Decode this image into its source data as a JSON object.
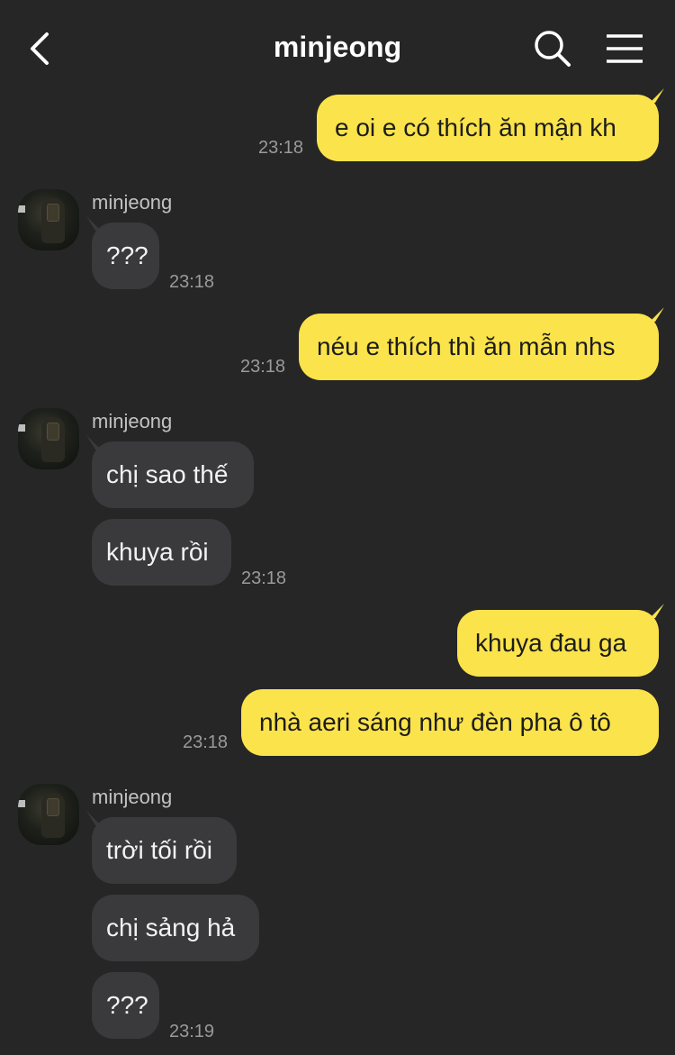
{
  "header": {
    "title": "minjeong",
    "back_icon": "chevron-left-icon",
    "search_icon": "search-icon",
    "menu_icon": "hamburger-menu-icon"
  },
  "colors": {
    "background": "#262626",
    "my_bubble": "#fbe34b",
    "their_bubble": "#3a3a3c",
    "timestamp": "#9a9a9a"
  },
  "messages": [
    {
      "from": "me",
      "text": "e oi e có thích ăn mận kh",
      "time": "23:18"
    },
    {
      "from": "minjeong",
      "sender": "minjeong",
      "text": "???",
      "time": "23:18"
    },
    {
      "from": "me",
      "text": "néu e thích thì ăn mẫn nhs",
      "time": "23:18"
    },
    {
      "from": "minjeong",
      "sender": "minjeong",
      "text": "chị sao thế"
    },
    {
      "from": "minjeong",
      "text": "khuya rồi",
      "time": "23:18"
    },
    {
      "from": "me",
      "text": "khuya đau ga"
    },
    {
      "from": "me",
      "text": "nhà aeri sáng như đèn pha ô tô",
      "time": "23:18"
    },
    {
      "from": "minjeong",
      "sender": "minjeong",
      "text": "trời tối rồi"
    },
    {
      "from": "minjeong",
      "text": "chị sảng hả"
    },
    {
      "from": "minjeong",
      "text": "???",
      "time": "23:19"
    }
  ]
}
